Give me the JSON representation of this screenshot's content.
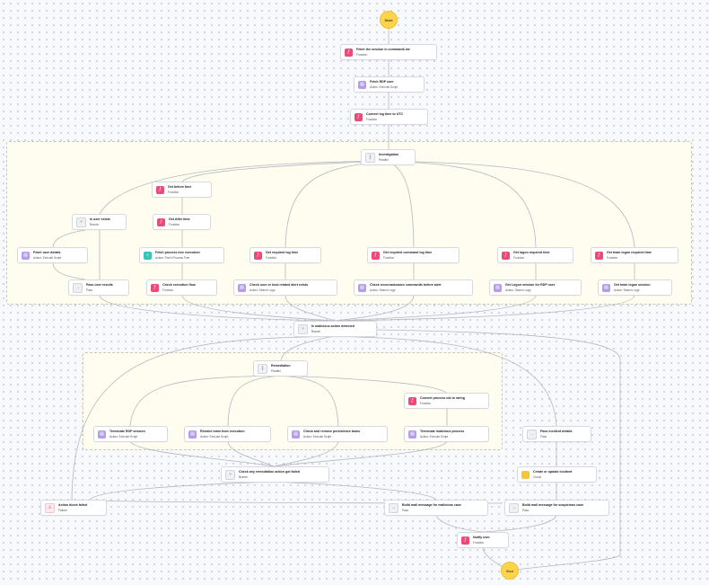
{
  "start": "Start",
  "end": "End",
  "nodes": {
    "fetch_session": {
      "title": "Fetch the session in commandLine",
      "sub": "Function"
    },
    "fetch_rdp": {
      "title": "Fetch RDP user",
      "sub": "Action: Execute Script"
    },
    "convert_log": {
      "title": "Convert log time to UTC",
      "sub": "Function"
    },
    "investigation": {
      "title": "Investigation",
      "sub": "Parallel"
    },
    "get_before": {
      "title": "Get before time",
      "sub": "Function"
    },
    "get_after": {
      "title": "Get After time",
      "sub": "Function"
    },
    "is_user_exists": {
      "title": "Is user exists",
      "sub": "Branch"
    },
    "fetch_user_details": {
      "title": "Fetch user details",
      "sub": "Action: Execute Script"
    },
    "fetch_process_tree": {
      "title": "Fetch process tree execution",
      "sub": "Action: Fetch Process Tree"
    },
    "get_req_log": {
      "title": "Get required log time",
      "sub": "Function"
    },
    "get_req_cmd_log": {
      "title": "Get required command log time",
      "sub": "Function"
    },
    "get_logon_req": {
      "title": "Get logon required time",
      "sub": "Function"
    },
    "get_team_logon_req": {
      "title": "Get team logon required time",
      "sub": "Function"
    },
    "pass_user_results": {
      "title": "Pass user results",
      "sub": "Pass"
    },
    "check_exec_flow": {
      "title": "Check execution flow",
      "sub": "Function"
    },
    "check_user_host_alert": {
      "title": "Check user or host related alert exists",
      "sub": "Action: Search Logs"
    },
    "check_recon_cmds": {
      "title": "Check reconnaissance commands before alert",
      "sub": "Action: Search Logs"
    },
    "get_logon_session": {
      "title": "Get Logon session for RDP user",
      "sub": "Action: Search Logs"
    },
    "get_team_logon_session": {
      "title": "Get team logon session",
      "sub": "Action: Search Logs"
    },
    "is_malicious": {
      "title": "Is malicious action detected",
      "sub": "Branch"
    },
    "remediation": {
      "title": "Remediation",
      "sub": "Parallel"
    },
    "convert_procs": {
      "title": "Convert process ids to string",
      "sub": "Function"
    },
    "terminate_rdp": {
      "title": "Terminate RDP session",
      "sub": "Action: Execute Script"
    },
    "restrict_team": {
      "title": "Restrict team from execution",
      "sub": "Action: Execute Script"
    },
    "check_persistence": {
      "title": "Check and remove persistence tasks",
      "sub": "Action: Execute Script"
    },
    "terminate_procs": {
      "title": "Terminate malicious process",
      "sub": "Action: Execute Script"
    },
    "pass_incident": {
      "title": "Pass incident details",
      "sub": "Pass"
    },
    "check_remediation_failed": {
      "title": "Check any remediation action got failed",
      "sub": "Branch"
    },
    "create_incident": {
      "title": "Create or update incident",
      "sub": "Circuit"
    },
    "action_block_failed": {
      "title": "Action block failed",
      "sub": "Failure"
    },
    "build_mail_malicious": {
      "title": "Build mail message for malicious case",
      "sub": "Pass"
    },
    "build_mail_suspicious": {
      "title": "Build mail message for suspicious case",
      "sub": "Pass"
    },
    "notify_user": {
      "title": "Notify user",
      "sub": "Function"
    }
  },
  "icons": {
    "function": "function-icon",
    "script": "script-icon",
    "process_tree": "process-tree-icon",
    "parallel": "parallel-icon",
    "branch": "branch-icon",
    "pass": "pass-icon",
    "circuit": "circuit-icon",
    "failure": "failure-icon"
  },
  "colors": {
    "function": "#ec4a78",
    "script": "#b39ce8",
    "process_tree": "#38c4b4",
    "circuit": "#f5c542",
    "terminal": "#fcd34d",
    "group_bg": "#fffdf0"
  }
}
